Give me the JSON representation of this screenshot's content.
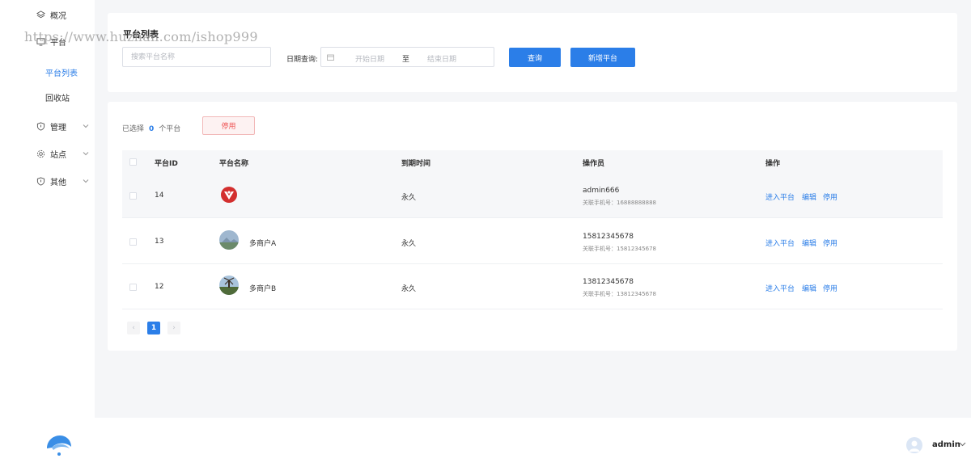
{
  "sidebar": {
    "items": [
      {
        "label": "概况",
        "icon": "layers-icon"
      },
      {
        "label": "平台",
        "icon": "monitor-icon"
      },
      {
        "label": "管理",
        "icon": "shield-icon"
      },
      {
        "label": "站点",
        "icon": "gear-icon"
      },
      {
        "label": "其他",
        "icon": "shield-icon"
      }
    ],
    "sub_items": [
      {
        "label": "平台列表",
        "active": true
      },
      {
        "label": "回收站",
        "active": false
      }
    ]
  },
  "watermark": "https://www.huzhan.com/ishop999",
  "header": {
    "title": "平台列表",
    "search_placeholder": "搜索平台名称",
    "date_label": "日期查询:",
    "date_start": "开始日期",
    "date_separator": "至",
    "date_end": "结束日期",
    "query_button": "查询",
    "add_button": "新增平台"
  },
  "toolbar": {
    "selected_prefix": "已选择",
    "selected_count": "0",
    "selected_suffix": "个平台",
    "disable_button": "停用"
  },
  "table": {
    "columns": [
      "平台ID",
      "平台名称",
      "到期时间",
      "操作员",
      "操作"
    ],
    "rows": [
      {
        "id": "14",
        "name": "",
        "expire": "永久",
        "operator": "admin666",
        "phone": "关联手机号：16888888888",
        "actions": [
          "进入平台",
          "编辑",
          "停用"
        ]
      },
      {
        "id": "13",
        "name": "多商户A",
        "expire": "永久",
        "operator": "15812345678",
        "phone": "关联手机号：15812345678",
        "actions": [
          "进入平台",
          "编辑",
          "停用"
        ]
      },
      {
        "id": "12",
        "name": "多商户B",
        "expire": "永久",
        "operator": "13812345678",
        "phone": "关联手机号：13812345678",
        "actions": [
          "进入平台",
          "编辑",
          "停用"
        ]
      }
    ]
  },
  "pagination": {
    "prev": "‹",
    "current": "1",
    "next": "›"
  },
  "footer": {
    "user_name": "admin"
  },
  "colors": {
    "primary": "#2b7ee8",
    "danger": "#ee5555",
    "background": "#f5f6f8"
  }
}
